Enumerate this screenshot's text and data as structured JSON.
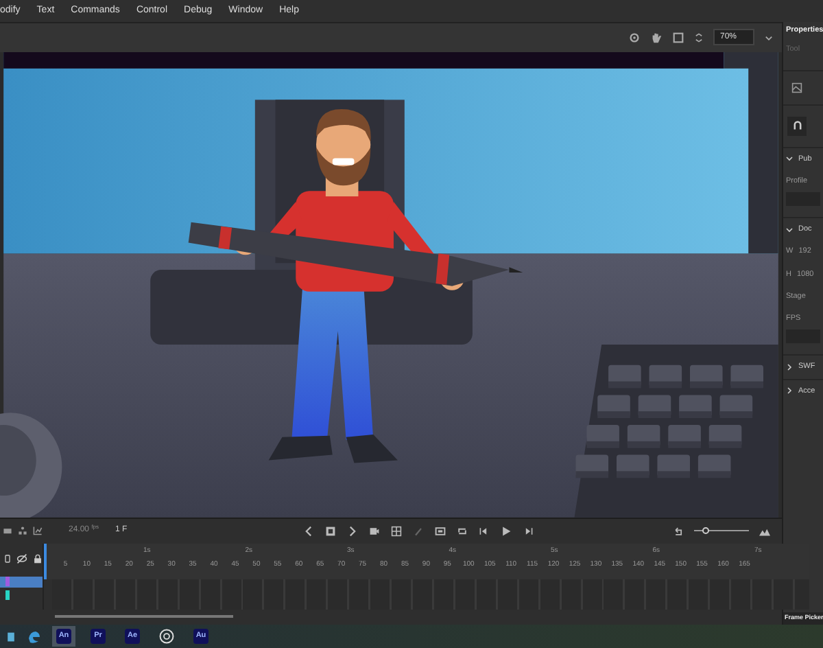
{
  "menu": [
    {
      "label": "odify"
    },
    {
      "label": "Text"
    },
    {
      "label": "Commands"
    },
    {
      "label": "Control"
    },
    {
      "label": "Debug"
    },
    {
      "label": "Window"
    },
    {
      "label": "Help"
    }
  ],
  "toolbar": {
    "zoom": "70%"
  },
  "properties": {
    "title": "Properties",
    "tool": "Tool",
    "sections": [
      {
        "title": "Pub",
        "expanded": true,
        "items": [
          {
            "label": "Profile"
          }
        ]
      },
      {
        "title": "Doc",
        "expanded": true,
        "items": [
          {
            "label": "W",
            "value": "192"
          },
          {
            "label": "H",
            "value": "1080"
          },
          {
            "label": "Stage"
          },
          {
            "label": "FPS"
          }
        ]
      },
      {
        "title": "SWF",
        "expanded": false
      },
      {
        "title": "Acce",
        "expanded": false
      }
    ],
    "bottom_tab": "Frame Picker"
  },
  "timeline": {
    "zoom_slider": {
      "level": 0.2
    },
    "fps": "24.00",
    "fps_unit": "fps",
    "frame": "1",
    "frame_unit": "F",
    "layers": [
      {
        "selected": true,
        "color": "#a05ce0"
      },
      {
        "selected": false,
        "color": "#27d4c4"
      }
    ],
    "seconds": [
      "1s",
      "2s",
      "3s",
      "4s",
      "5s",
      "6s",
      "7s"
    ],
    "frame_numbers": [
      "5",
      "10",
      "15",
      "20",
      "25",
      "30",
      "35",
      "40",
      "45",
      "50",
      "55",
      "60",
      "65",
      "70",
      "75",
      "80",
      "85",
      "90",
      "95",
      "100",
      "105",
      "110",
      "115",
      "120",
      "125",
      "130",
      "135",
      "140",
      "145",
      "150",
      "155",
      "160",
      "165"
    ]
  },
  "taskbar": [
    {
      "kind": "app",
      "label": "An",
      "active": true
    },
    {
      "kind": "app",
      "label": "Pr",
      "active": false
    },
    {
      "kind": "app",
      "label": "Ae",
      "active": false
    },
    {
      "kind": "aperture",
      "active": false
    },
    {
      "kind": "app",
      "label": "Au",
      "active": false
    }
  ]
}
